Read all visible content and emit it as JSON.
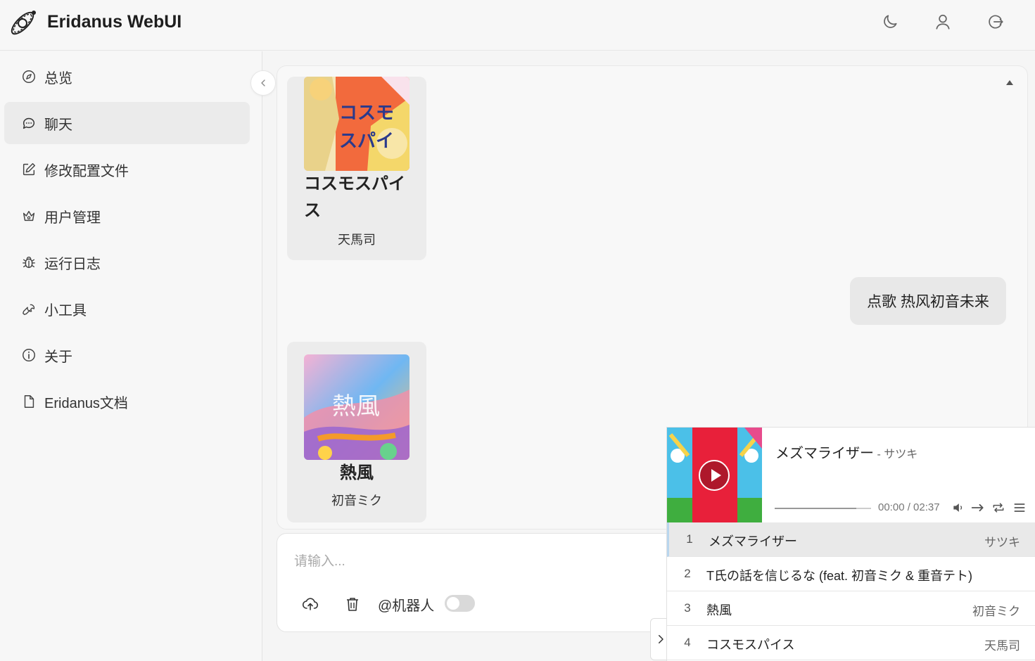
{
  "app": {
    "title": "Eridanus WebUI"
  },
  "header": {
    "icons": [
      "moon-icon",
      "user-icon",
      "logout-icon"
    ]
  },
  "sidebar": {
    "items": [
      {
        "label": "总览",
        "icon": "compass-icon",
        "active": false
      },
      {
        "label": "聊天",
        "icon": "chat-icon",
        "active": true
      },
      {
        "label": "修改配置文件",
        "icon": "edit-icon",
        "active": false
      },
      {
        "label": "用户管理",
        "icon": "crown-icon",
        "active": false
      },
      {
        "label": "运行日志",
        "icon": "bug-icon",
        "active": false
      },
      {
        "label": "小工具",
        "icon": "wrench-icon",
        "active": false
      },
      {
        "label": "关于",
        "icon": "info-icon",
        "active": false
      },
      {
        "label": "Eridanus文档",
        "icon": "file-icon",
        "active": false
      }
    ]
  },
  "chat": {
    "messages": [
      {
        "type": "song_card",
        "title": "コスモスパイス",
        "artist": "天馬司"
      },
      {
        "type": "user_text",
        "text": "点歌 热风初音未来"
      },
      {
        "type": "song_card",
        "title": "熱風",
        "artist": "初音ミク"
      }
    ]
  },
  "input": {
    "placeholder": "请输入...",
    "at_bot_label": "@机器人",
    "at_bot_enabled": false
  },
  "player": {
    "title": "メズマライザー",
    "artist_sep": " - ",
    "artist": "サツキ",
    "time": "00:00 / 02:37",
    "progress": 0.85,
    "playlist": [
      {
        "num": "1",
        "title": "メズマライザー",
        "artist": "サツキ",
        "active": true
      },
      {
        "num": "2",
        "title": "T氏の話を信じるな (feat. 初音ミク & 重音テト)",
        "artist": "",
        "active": false
      },
      {
        "num": "3",
        "title": "熱風",
        "artist": "初音ミク",
        "active": false
      },
      {
        "num": "4",
        "title": "コスモスパイス",
        "artist": "天馬司",
        "active": false
      }
    ]
  },
  "colors": {
    "accent_active_row": "#b9d6ee",
    "sidebar_active_bg": "#ebebeb"
  }
}
